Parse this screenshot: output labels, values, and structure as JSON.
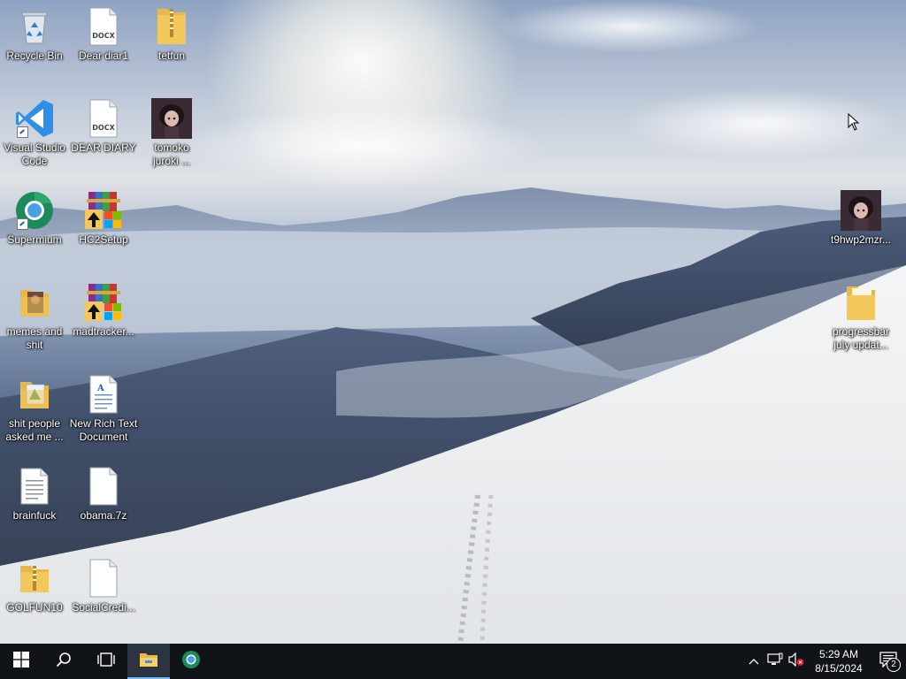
{
  "desktop": {
    "icons": [
      {
        "label": "Recycle Bin",
        "icon": "recycle-bin-icon"
      },
      {
        "label": "Dear diar1",
        "icon": "docx-file-icon"
      },
      {
        "label": "tetfun",
        "icon": "zip-folder-icon"
      },
      {
        "label": "Visual Studio\nCode",
        "icon": "vscode-icon"
      },
      {
        "label": "DEAR DIARY",
        "icon": "docx-file-icon"
      },
      {
        "label": "tomoko\njuroki ...",
        "icon": "image-thumbnail-icon"
      },
      {
        "label": "Supermium",
        "icon": "supermium-browser-icon"
      },
      {
        "label": "HC2Setup",
        "icon": "winrar-installer-icon"
      },
      {
        "label": "memes and\nshit",
        "icon": "folder-icon"
      },
      {
        "label": "madtracker...",
        "icon": "winrar-installer-icon"
      },
      {
        "label": "shit people\nasked me ...",
        "icon": "folder-icon"
      },
      {
        "label": "New Rich Text\nDocument",
        "icon": "rtf-file-icon"
      },
      {
        "label": "brainfuck",
        "icon": "text-file-icon"
      },
      {
        "label": "obama.7z",
        "icon": "blank-file-icon"
      },
      {
        "label": "GOLFUN10",
        "icon": "zip-folder-icon"
      },
      {
        "label": "SocialCredi...",
        "icon": "blank-file-icon"
      },
      {
        "label": "t9hwp2mzr...",
        "icon": "image-thumbnail-icon"
      },
      {
        "label": "progressbar\njuly updat...",
        "icon": "folder-icon"
      }
    ]
  },
  "taskbar": {
    "start": "windows-start-icon",
    "search": "search-icon",
    "task_view": "task-view-icon",
    "pinned": [
      "file-explorer-icon",
      "supermium-browser-icon"
    ],
    "tray": [
      "chevron-up-icon",
      "network-icon",
      "volume-muted-icon"
    ],
    "clock": {
      "time": "5:29 AM",
      "date": "8/15/2024"
    },
    "notifications": {
      "icon": "action-center-icon",
      "count": "2"
    }
  },
  "colors": {
    "taskbar_bg": "#101419",
    "accent": "#76b9ed",
    "folder": "#f2c75c"
  }
}
